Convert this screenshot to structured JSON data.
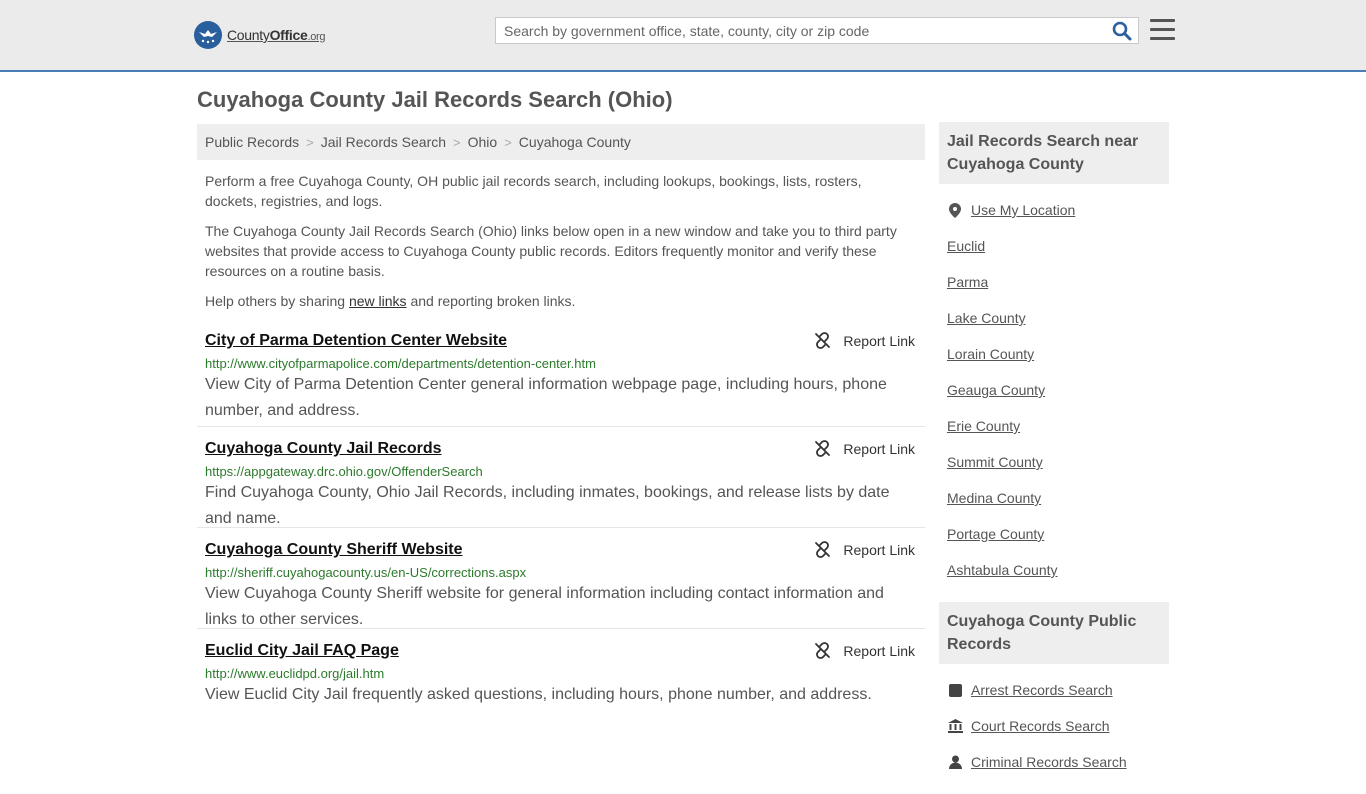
{
  "header": {
    "logo": {
      "name": "County",
      "name_bold": "Office",
      "tld": ".org"
    },
    "search": {
      "placeholder": "Search by government office, state, county, city or zip code"
    }
  },
  "page": {
    "title": "Cuyahoga County Jail Records Search (Ohio)"
  },
  "breadcrumb": [
    "Public Records",
    "Jail Records Search",
    "Ohio",
    "Cuyahoga County"
  ],
  "intro": {
    "p1": "Perform a free Cuyahoga County, OH public jail records search, including lookups, bookings, lists, rosters, dockets, registries, and logs.",
    "p2": "The Cuyahoga County Jail Records Search (Ohio) links below open in a new window and take you to third party websites that provide access to Cuyahoga County public records. Editors frequently monitor and verify these resources on a routine basis.",
    "p3_before": "Help others by sharing ",
    "p3_link": "new links",
    "p3_after": " and reporting broken links."
  },
  "report_label": "Report Link",
  "results": [
    {
      "title": "City of Parma Detention Center Website",
      "url": "http://www.cityofparmapolice.com/departments/detention-center.htm",
      "desc": "View City of Parma Detention Center general information webpage page, including hours, phone number, and address."
    },
    {
      "title": "Cuyahoga County Jail Records",
      "url": "https://appgateway.drc.ohio.gov/OffenderSearch",
      "desc": "Find Cuyahoga County, Ohio Jail Records, including inmates, bookings, and release lists by date and name."
    },
    {
      "title": "Cuyahoga County Sheriff Website",
      "url": "http://sheriff.cuyahogacounty.us/en-US/corrections.aspx",
      "desc": "View Cuyahoga County Sheriff website for general information including contact information and links to other services."
    },
    {
      "title": "Euclid City Jail FAQ Page",
      "url": "http://www.euclidpd.org/jail.htm",
      "desc": "View Euclid City Jail frequently asked questions, including hours, phone number, and address."
    }
  ],
  "sidebar": {
    "nearby": {
      "heading": "Jail Records Search near Cuyahoga County",
      "use_location": "Use My Location",
      "items": [
        "Euclid",
        "Parma",
        "Lake County",
        "Lorain County",
        "Geauga County",
        "Erie County",
        "Summit County",
        "Medina County",
        "Portage County",
        "Ashtabula County"
      ]
    },
    "public_records": {
      "heading": "Cuyahoga County Public Records",
      "items": [
        "Arrest Records Search",
        "Court Records Search",
        "Criminal Records Search"
      ]
    }
  },
  "colors": {
    "accent": "#4a7cb8",
    "url_green": "#2c7a2c",
    "logo_blue": "#2a5f9e"
  }
}
